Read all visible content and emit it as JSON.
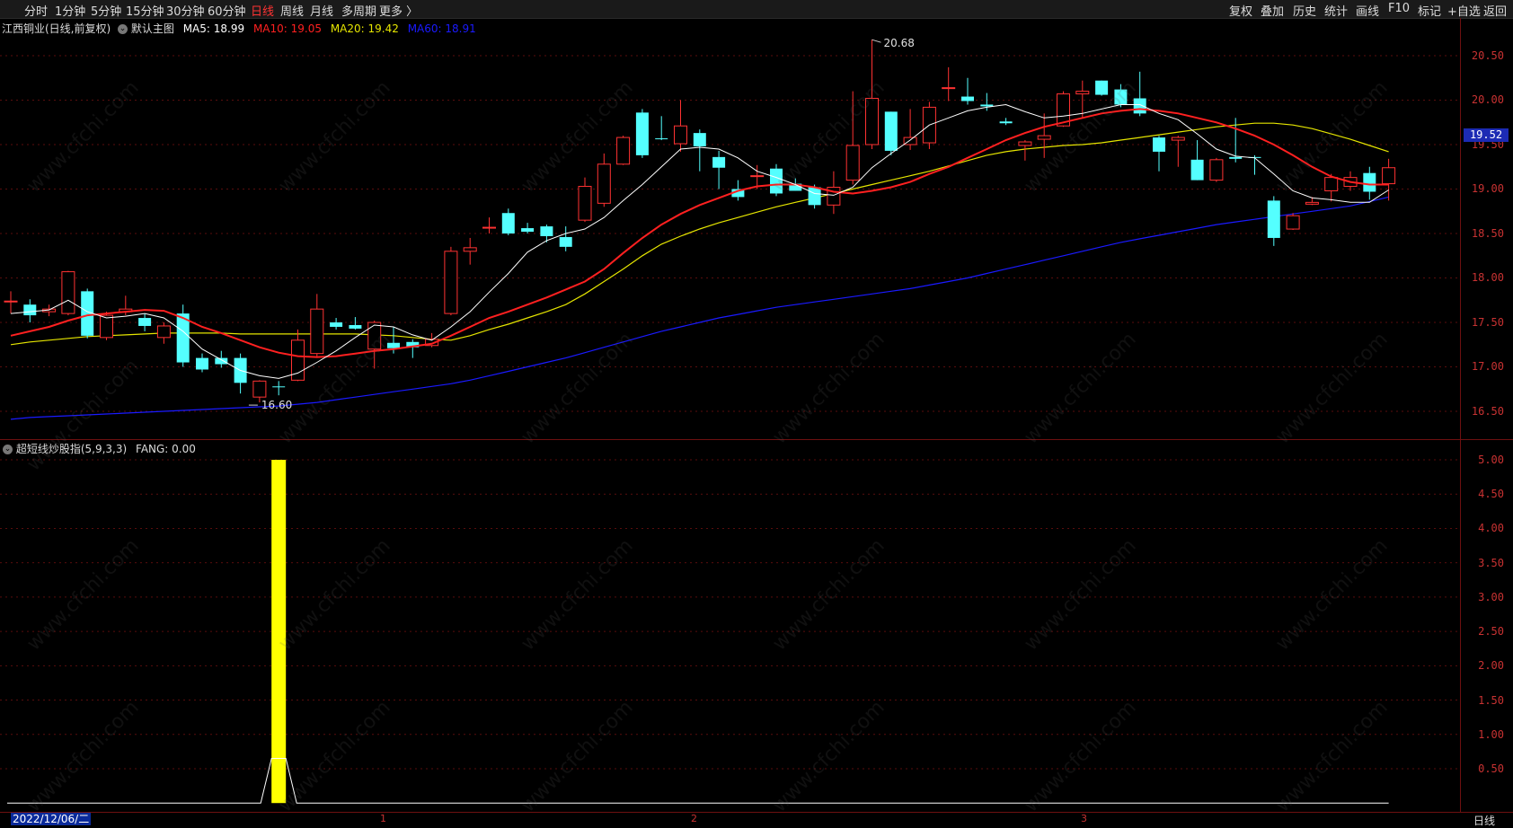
{
  "toolbar": {
    "left_items": [
      "分时",
      "1分钟",
      "5分钟",
      "15分钟",
      "30分钟",
      "60分钟",
      "日线",
      "周线",
      "月线",
      "多周期",
      "更多 〉"
    ],
    "active_item": "日线",
    "right_items": [
      "复权",
      "叠加",
      "历史",
      "统计",
      "画线",
      "F10",
      "标记",
      "+自选",
      "返回"
    ]
  },
  "main_legend": {
    "stock": "江西铜业(日线,前复权)",
    "template": "默认主图",
    "ma5": "MA5: 18.99",
    "ma10": "MA10: 19.05",
    "ma20": "MA20: 19.42",
    "ma60": "MA60: 18.91"
  },
  "indicator_legend": {
    "name": "超短线炒股指(5,9,3,3)",
    "value": "FANG: 0.00"
  },
  "price_axis": [
    "20.50",
    "20.00",
    "19.50",
    "19.00",
    "18.50",
    "18.00",
    "17.50",
    "17.00",
    "16.50"
  ],
  "current_price": "19.52",
  "high_label": "20.68",
  "low_label": "16.60",
  "indicator_axis": [
    "5.00",
    "4.50",
    "4.00",
    "3.50",
    "3.00",
    "2.50",
    "2.00",
    "1.50",
    "1.00",
    "0.50"
  ],
  "x_ticks": [
    "1",
    "2",
    "3"
  ],
  "date_box": "2022/12/06/二",
  "bottom_tag": "日线",
  "watermark_text": "www.cfchi.com",
  "colors": {
    "up": "#ff3232",
    "down": "#54ffff",
    "ma5": "#ffffff",
    "ma10": "#ff2020",
    "ma20": "#e5e500",
    "ma60": "#1a1aff",
    "fang": "#ffff00"
  },
  "chart_data": {
    "type": "candlestick",
    "candles": [
      {
        "o": 17.73,
        "h": 17.85,
        "l": 17.6,
        "c": 17.74
      },
      {
        "o": 17.7,
        "h": 17.76,
        "l": 17.5,
        "c": 17.58
      },
      {
        "o": 17.62,
        "h": 17.7,
        "l": 17.57,
        "c": 17.65
      },
      {
        "o": 17.6,
        "h": 18.08,
        "l": 17.58,
        "c": 18.07
      },
      {
        "o": 17.85,
        "h": 17.88,
        "l": 17.32,
        "c": 17.35
      },
      {
        "o": 17.33,
        "h": 17.62,
        "l": 17.3,
        "c": 17.58
      },
      {
        "o": 17.62,
        "h": 17.8,
        "l": 17.58,
        "c": 17.65
      },
      {
        "o": 17.55,
        "h": 17.6,
        "l": 17.4,
        "c": 17.46
      },
      {
        "o": 17.33,
        "h": 17.5,
        "l": 17.26,
        "c": 17.46
      },
      {
        "o": 17.6,
        "h": 17.7,
        "l": 17.0,
        "c": 17.05
      },
      {
        "o": 17.1,
        "h": 17.15,
        "l": 16.94,
        "c": 16.97
      },
      {
        "o": 17.1,
        "h": 17.18,
        "l": 16.99,
        "c": 17.03
      },
      {
        "o": 17.1,
        "h": 17.15,
        "l": 16.7,
        "c": 16.82
      },
      {
        "o": 16.66,
        "h": 16.85,
        "l": 16.6,
        "c": 16.84
      },
      {
        "o": 16.78,
        "h": 16.84,
        "l": 16.68,
        "c": 16.77
      },
      {
        "o": 16.85,
        "h": 17.42,
        "l": 16.84,
        "c": 17.3
      },
      {
        "o": 17.15,
        "h": 17.82,
        "l": 17.1,
        "c": 17.65
      },
      {
        "o": 17.5,
        "h": 17.55,
        "l": 17.42,
        "c": 17.45
      },
      {
        "o": 17.47,
        "h": 17.56,
        "l": 17.42,
        "c": 17.43
      },
      {
        "o": 17.2,
        "h": 17.52,
        "l": 16.98,
        "c": 17.5
      },
      {
        "o": 17.27,
        "h": 17.45,
        "l": 17.15,
        "c": 17.21
      },
      {
        "o": 17.28,
        "h": 17.31,
        "l": 17.1,
        "c": 17.22
      },
      {
        "o": 17.24,
        "h": 17.38,
        "l": 17.22,
        "c": 17.31
      },
      {
        "o": 17.6,
        "h": 18.35,
        "l": 17.58,
        "c": 18.3
      },
      {
        "o": 18.3,
        "h": 18.45,
        "l": 18.15,
        "c": 18.34
      },
      {
        "o": 18.57,
        "h": 18.68,
        "l": 18.5,
        "c": 18.57
      },
      {
        "o": 18.73,
        "h": 18.78,
        "l": 18.48,
        "c": 18.5
      },
      {
        "o": 18.56,
        "h": 18.62,
        "l": 18.5,
        "c": 18.52
      },
      {
        "o": 18.58,
        "h": 18.6,
        "l": 18.4,
        "c": 18.47
      },
      {
        "o": 18.46,
        "h": 18.58,
        "l": 18.3,
        "c": 18.35
      },
      {
        "o": 18.65,
        "h": 19.13,
        "l": 18.63,
        "c": 19.03
      },
      {
        "o": 18.84,
        "h": 19.4,
        "l": 18.8,
        "c": 19.28
      },
      {
        "o": 19.28,
        "h": 19.6,
        "l": 19.27,
        "c": 19.58
      },
      {
        "o": 19.86,
        "h": 19.9,
        "l": 19.35,
        "c": 19.38
      },
      {
        "o": 19.57,
        "h": 19.82,
        "l": 19.55,
        "c": 19.56
      },
      {
        "o": 19.51,
        "h": 20.0,
        "l": 19.42,
        "c": 19.71
      },
      {
        "o": 19.63,
        "h": 19.67,
        "l": 19.2,
        "c": 19.48
      },
      {
        "o": 19.36,
        "h": 19.43,
        "l": 19.0,
        "c": 19.24
      },
      {
        "o": 19.0,
        "h": 19.1,
        "l": 18.87,
        "c": 18.91
      },
      {
        "o": 19.15,
        "h": 19.27,
        "l": 19.0,
        "c": 19.15
      },
      {
        "o": 19.23,
        "h": 19.28,
        "l": 18.92,
        "c": 18.95
      },
      {
        "o": 19.06,
        "h": 19.12,
        "l": 18.98,
        "c": 18.98
      },
      {
        "o": 19.02,
        "h": 19.05,
        "l": 18.78,
        "c": 18.82
      },
      {
        "o": 18.82,
        "h": 19.2,
        "l": 18.72,
        "c": 19.02
      },
      {
        "o": 19.1,
        "h": 20.1,
        "l": 19.05,
        "c": 19.49
      },
      {
        "o": 19.5,
        "h": 20.68,
        "l": 19.45,
        "c": 20.02
      },
      {
        "o": 19.87,
        "h": 19.87,
        "l": 19.38,
        "c": 19.43
      },
      {
        "o": 19.5,
        "h": 19.9,
        "l": 19.44,
        "c": 19.58
      },
      {
        "o": 19.52,
        "h": 19.98,
        "l": 19.45,
        "c": 19.92
      },
      {
        "o": 20.13,
        "h": 20.37,
        "l": 19.99,
        "c": 20.14
      },
      {
        "o": 20.04,
        "h": 20.25,
        "l": 19.95,
        "c": 19.99
      },
      {
        "o": 19.95,
        "h": 20.08,
        "l": 19.88,
        "c": 19.93
      },
      {
        "o": 19.76,
        "h": 19.8,
        "l": 19.72,
        "c": 19.74
      },
      {
        "o": 19.49,
        "h": 19.55,
        "l": 19.32,
        "c": 19.53
      },
      {
        "o": 19.56,
        "h": 19.85,
        "l": 19.35,
        "c": 19.6
      },
      {
        "o": 19.71,
        "h": 20.1,
        "l": 19.7,
        "c": 20.07
      },
      {
        "o": 20.07,
        "h": 20.22,
        "l": 19.8,
        "c": 20.1
      },
      {
        "o": 20.22,
        "h": 20.22,
        "l": 20.05,
        "c": 20.06
      },
      {
        "o": 20.12,
        "h": 20.18,
        "l": 19.92,
        "c": 19.95
      },
      {
        "o": 20.02,
        "h": 20.32,
        "l": 19.82,
        "c": 19.85
      },
      {
        "o": 19.58,
        "h": 19.6,
        "l": 19.2,
        "c": 19.42
      },
      {
        "o": 19.55,
        "h": 19.6,
        "l": 19.25,
        "c": 19.58
      },
      {
        "o": 19.33,
        "h": 19.55,
        "l": 19.1,
        "c": 19.1
      },
      {
        "o": 19.1,
        "h": 19.35,
        "l": 19.08,
        "c": 19.33
      },
      {
        "o": 19.36,
        "h": 19.8,
        "l": 19.3,
        "c": 19.34
      },
      {
        "o": 19.36,
        "h": 19.38,
        "l": 19.16,
        "c": 19.35
      },
      {
        "o": 18.87,
        "h": 18.92,
        "l": 18.36,
        "c": 18.45
      },
      {
        "o": 18.55,
        "h": 18.73,
        "l": 18.54,
        "c": 18.7
      },
      {
        "o": 18.83,
        "h": 18.91,
        "l": 18.82,
        "c": 18.85
      },
      {
        "o": 18.98,
        "h": 19.17,
        "l": 18.86,
        "c": 19.13
      },
      {
        "o": 19.03,
        "h": 19.2,
        "l": 18.98,
        "c": 19.13
      },
      {
        "o": 19.18,
        "h": 19.25,
        "l": 18.88,
        "c": 18.97
      },
      {
        "o": 19.06,
        "h": 19.34,
        "l": 18.87,
        "c": 19.24
      }
    ],
    "ma5": [
      17.6,
      17.62,
      17.64,
      17.75,
      17.62,
      17.55,
      17.57,
      17.6,
      17.55,
      17.4,
      17.2,
      17.08,
      16.96,
      16.9,
      16.87,
      16.93,
      17.05,
      17.18,
      17.33,
      17.47,
      17.45,
      17.36,
      17.3,
      17.45,
      17.62,
      17.84,
      18.05,
      18.29,
      18.42,
      18.5,
      18.55,
      18.68,
      18.87,
      19.05,
      19.25,
      19.45,
      19.47,
      19.45,
      19.35,
      19.2,
      19.13,
      19.05,
      18.95,
      18.93,
      19.02,
      19.24,
      19.4,
      19.55,
      19.72,
      19.8,
      19.88,
      19.92,
      19.95,
      19.87,
      19.8,
      19.82,
      19.85,
      19.9,
      19.95,
      19.95,
      19.85,
      19.78,
      19.62,
      19.45,
      19.37,
      19.35,
      19.17,
      18.98,
      18.9,
      18.88,
      18.85,
      18.85,
      18.99
    ],
    "ma10": [
      17.35,
      17.4,
      17.45,
      17.52,
      17.58,
      17.6,
      17.62,
      17.64,
      17.63,
      17.55,
      17.45,
      17.38,
      17.3,
      17.22,
      17.16,
      17.12,
      17.11,
      17.12,
      17.15,
      17.18,
      17.2,
      17.23,
      17.26,
      17.35,
      17.45,
      17.55,
      17.62,
      17.7,
      17.78,
      17.87,
      17.96,
      18.1,
      18.28,
      18.45,
      18.6,
      18.72,
      18.82,
      18.9,
      18.98,
      19.03,
      19.05,
      19.05,
      19.02,
      18.97,
      18.95,
      18.98,
      19.02,
      19.08,
      19.17,
      19.25,
      19.35,
      19.45,
      19.55,
      19.63,
      19.7,
      19.75,
      19.8,
      19.85,
      19.88,
      19.9,
      19.88,
      19.85,
      19.8,
      19.75,
      19.68,
      19.6,
      19.5,
      19.38,
      19.25,
      19.14,
      19.08,
      19.05,
      19.05
    ],
    "ma20": [
      17.25,
      17.28,
      17.3,
      17.32,
      17.34,
      17.35,
      17.36,
      17.37,
      17.38,
      17.38,
      17.38,
      17.38,
      17.37,
      17.37,
      17.37,
      17.37,
      17.37,
      17.37,
      17.37,
      17.36,
      17.35,
      17.33,
      17.31,
      17.3,
      17.35,
      17.42,
      17.48,
      17.55,
      17.62,
      17.7,
      17.82,
      17.96,
      18.1,
      18.25,
      18.38,
      18.47,
      18.55,
      18.62,
      18.68,
      18.74,
      18.8,
      18.85,
      18.9,
      18.95,
      19.0,
      19.05,
      19.1,
      19.15,
      19.2,
      19.26,
      19.32,
      19.38,
      19.42,
      19.45,
      19.47,
      19.49,
      19.5,
      19.52,
      19.55,
      19.58,
      19.61,
      19.64,
      19.67,
      19.7,
      19.72,
      19.74,
      19.74,
      19.72,
      19.68,
      19.62,
      19.56,
      19.49,
      19.42
    ],
    "ma60": [
      16.41,
      16.43,
      16.44,
      16.45,
      16.46,
      16.47,
      16.48,
      16.49,
      16.5,
      16.51,
      16.52,
      16.53,
      16.54,
      16.55,
      16.56,
      16.58,
      16.6,
      16.63,
      16.66,
      16.69,
      16.72,
      16.75,
      16.78,
      16.81,
      16.85,
      16.9,
      16.95,
      17.0,
      17.05,
      17.1,
      17.16,
      17.22,
      17.28,
      17.34,
      17.4,
      17.45,
      17.5,
      17.55,
      17.59,
      17.63,
      17.67,
      17.7,
      17.73,
      17.76,
      17.79,
      17.82,
      17.85,
      17.88,
      17.92,
      17.96,
      18.0,
      18.05,
      18.1,
      18.15,
      18.2,
      18.25,
      18.3,
      18.35,
      18.4,
      18.44,
      18.48,
      18.52,
      18.56,
      18.6,
      18.63,
      18.66,
      18.69,
      18.72,
      18.75,
      18.78,
      18.81,
      18.86,
      18.91
    ],
    "fang": [
      {
        "index": 14,
        "value": 5.0
      }
    ],
    "fang_line_peak": {
      "index": 14,
      "value": 0.65
    },
    "price_range": [
      16.37,
      20.73
    ],
    "indicator_range": [
      0,
      5.2
    ]
  }
}
